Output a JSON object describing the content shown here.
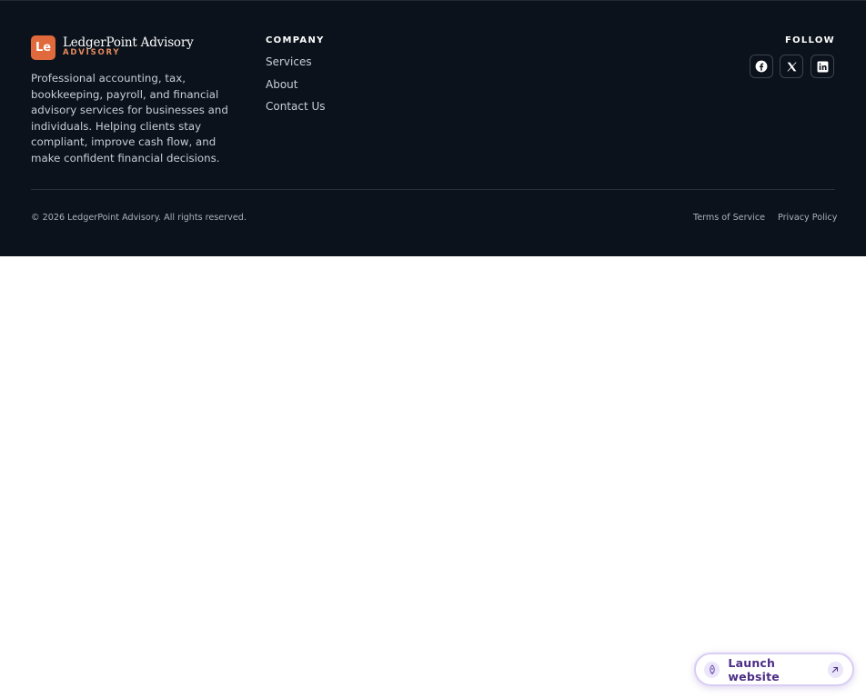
{
  "brand": {
    "mark": "Le",
    "name": "LedgerPoint Advisory",
    "subtitle": "ADVISORY",
    "description": "Professional accounting, tax, bookkeeping, payroll, and financial advisory services for businesses and individuals. Helping clients stay compliant, improve cash flow, and make confident financial decisions."
  },
  "company": {
    "title": "COMPANY",
    "links": [
      "Services",
      "About",
      "Contact Us"
    ]
  },
  "follow": {
    "title": "FOLLOW",
    "icons": [
      "facebook-icon",
      "x-icon",
      "linkedin-icon"
    ]
  },
  "bottom": {
    "copyright": "© 2026 LedgerPoint Advisory. All rights reserved.",
    "terms": "Terms of Service",
    "privacy": "Privacy Policy"
  },
  "launch": {
    "label": "Launch website"
  },
  "colors": {
    "footer_bg": "#0b121b",
    "brand_accent": "#e06a3b",
    "launch_text": "#4b2d85"
  }
}
